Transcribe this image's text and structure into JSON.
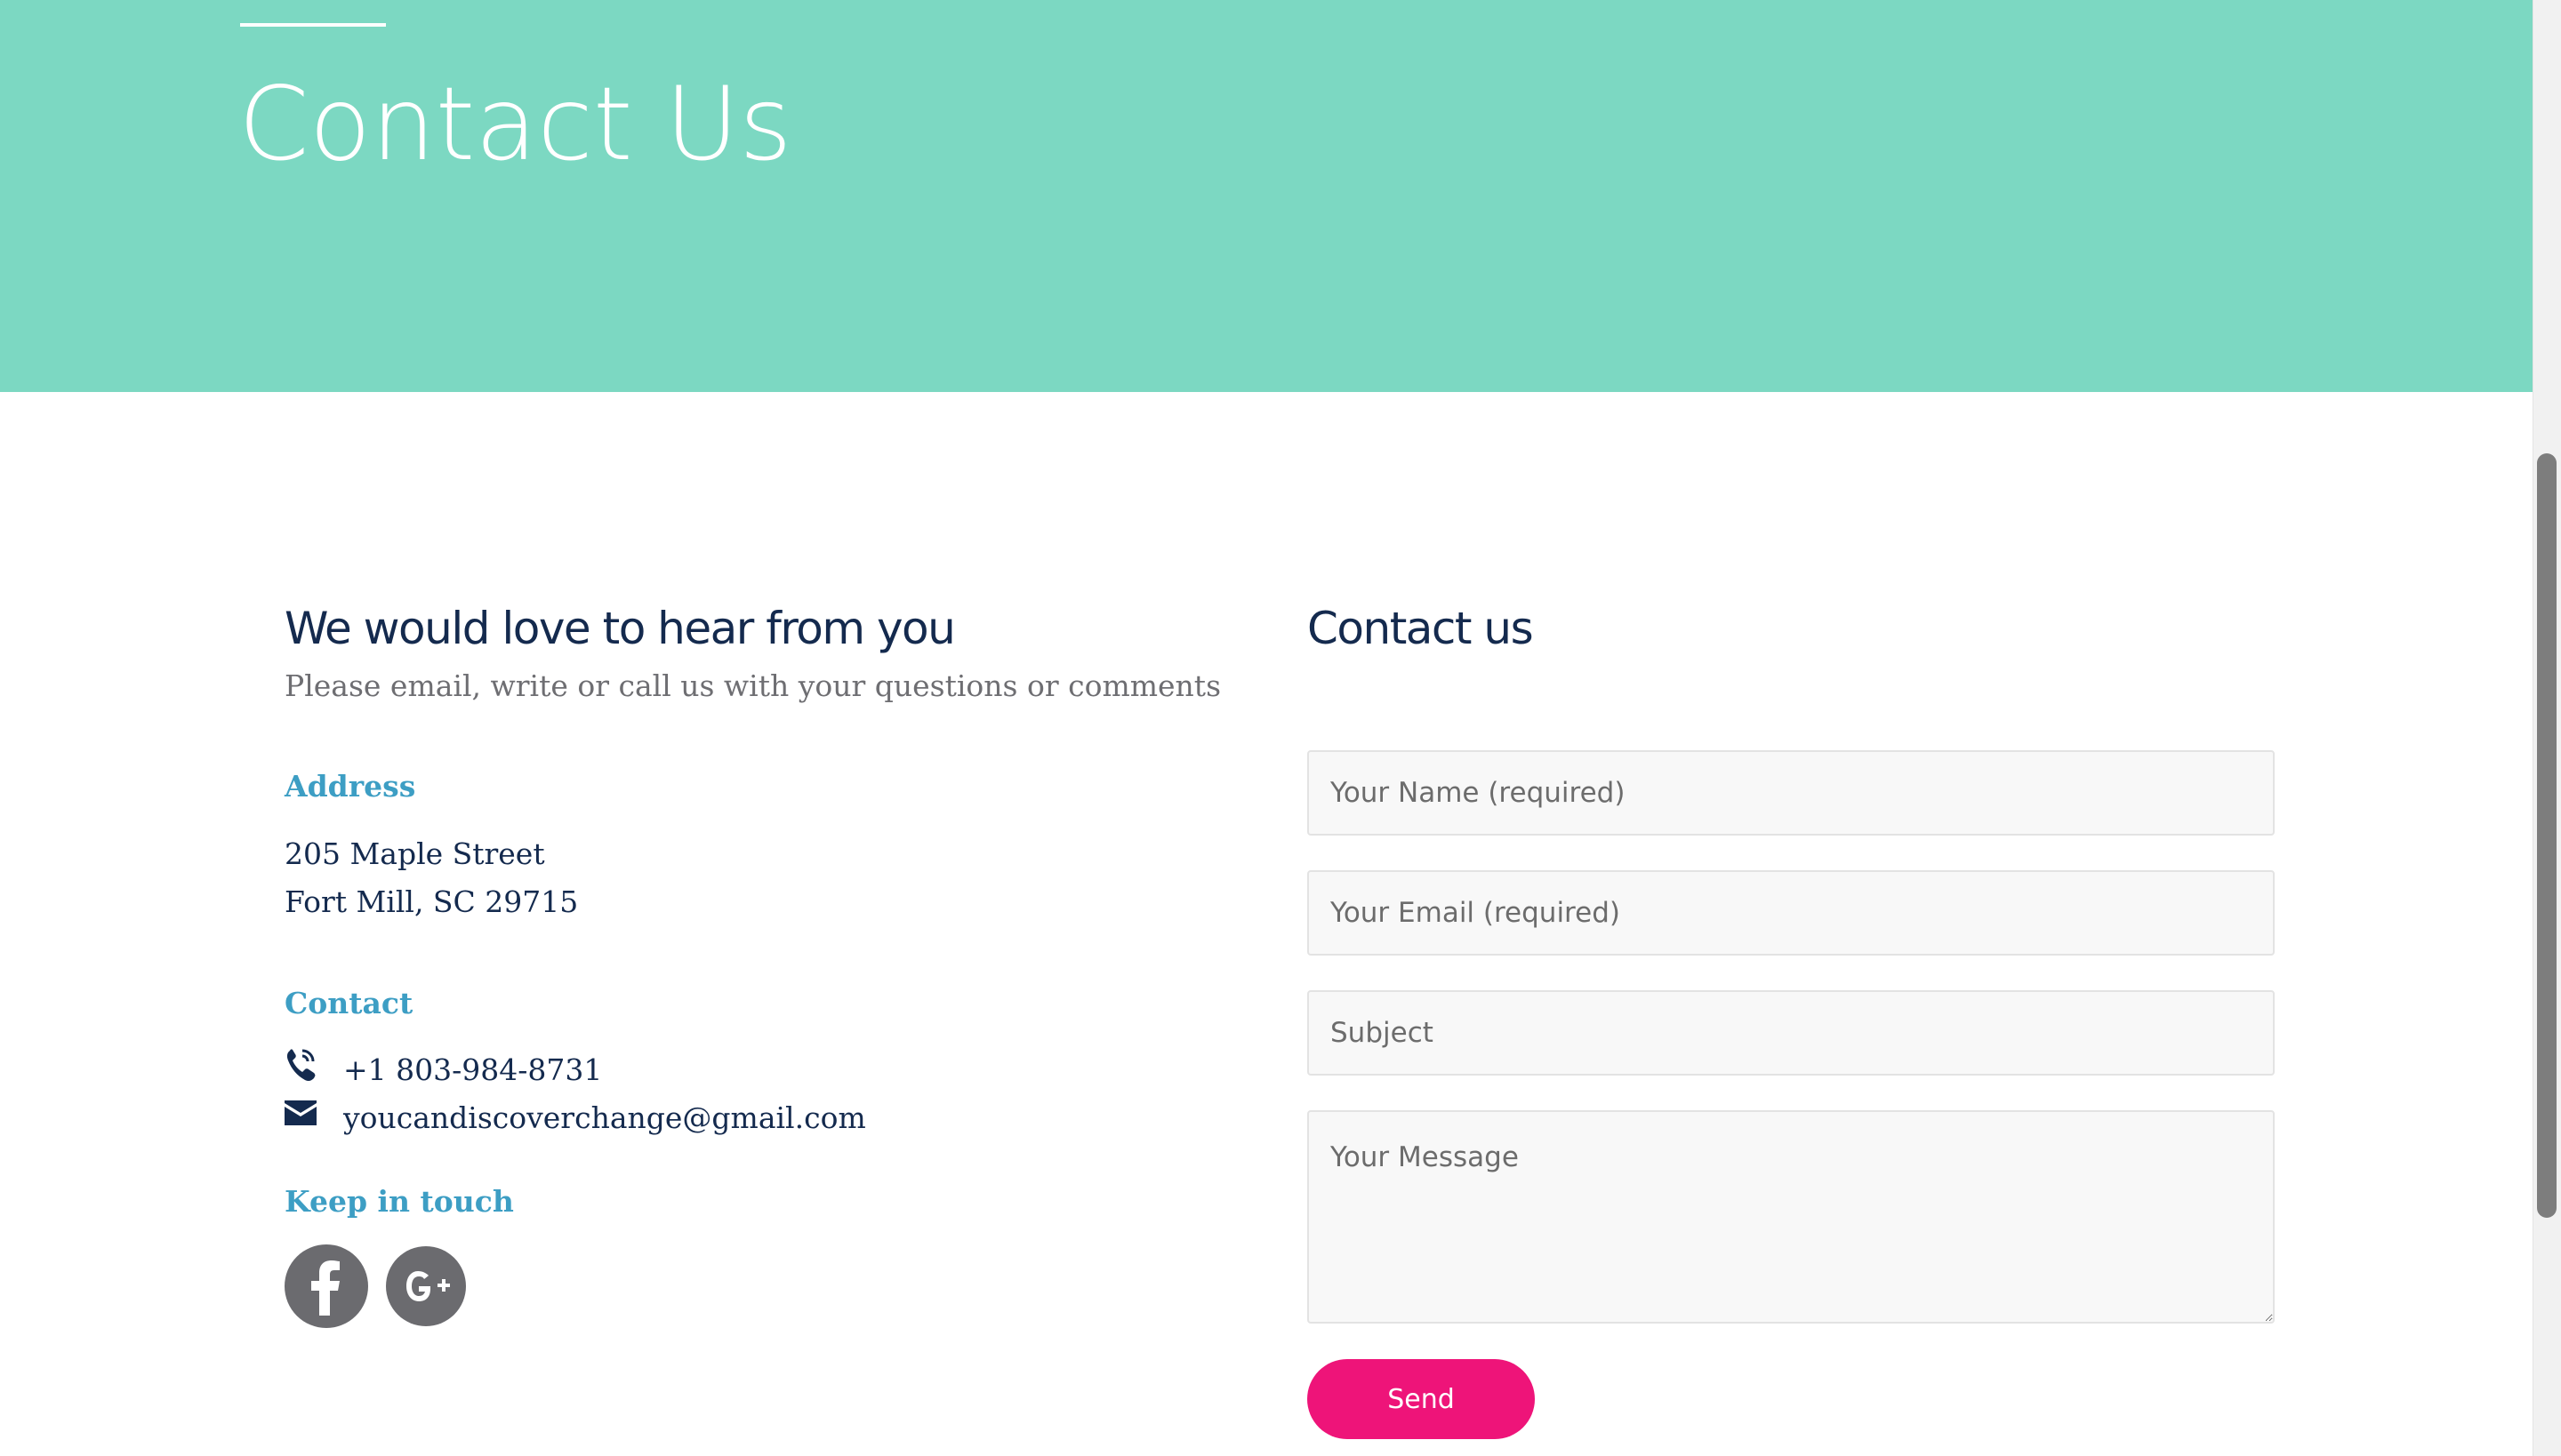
{
  "hero": {
    "title": "Contact Us",
    "background_color": "#7cd8c2"
  },
  "intro": {
    "heading": "We would love to hear from you",
    "subheading": "Please email, write or call us with your questions or comments"
  },
  "address": {
    "label": "Address",
    "line1": "205 Maple Street",
    "line2": "Fort Mill, SC 29715"
  },
  "contact": {
    "label": "Contact",
    "phone": "+1 803-984-8731",
    "phone_icon": "phone-icon",
    "email": "youcandiscoverchange@gmail.com",
    "email_icon": "envelope-icon"
  },
  "social": {
    "label": "Keep in touch",
    "items": [
      {
        "icon": "facebook-icon"
      },
      {
        "icon": "google-plus-icon"
      }
    ]
  },
  "form": {
    "heading": "Contact us",
    "name_placeholder": "Your Name (required)",
    "email_placeholder": "Your Email (required)",
    "subject_placeholder": "Subject",
    "message_placeholder": "Your Message",
    "send_label": "Send",
    "send_color": "#ee1479"
  },
  "colors": {
    "heading": "#142a4e",
    "accent": "#3d9ec4",
    "body_text": "#6e6e72"
  }
}
